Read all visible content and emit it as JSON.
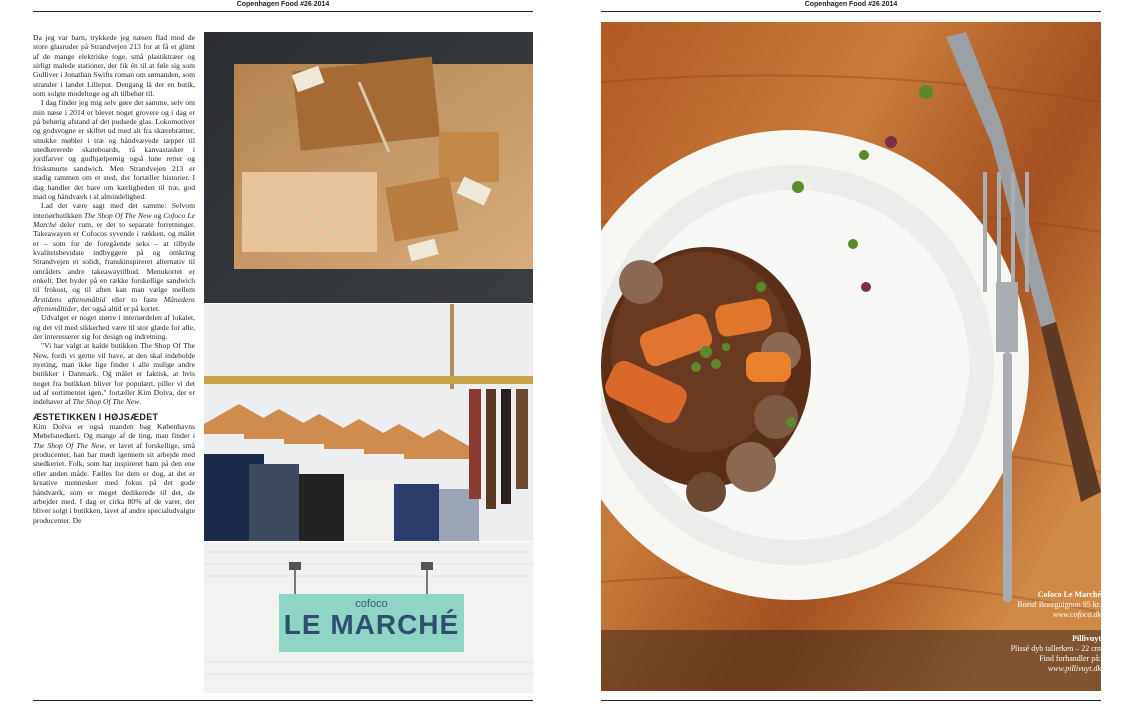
{
  "header": {
    "left": "Copenhagen Food #26 2014",
    "right": "Copenhagen Food #26 2014"
  },
  "article": {
    "p1": "Da jeg var barn, trykkede jeg næsen flad mod de store glasruder på Strandvejen 213 for at få et glimt af de mange elektriske toge, små plastiktræer og sirligt malede stationer, der fik én til at føle sig som Gulliver i Jonathan Swifts roman om sømanden, som strander i landet Lilleput. Dengang lå der en butik, som solgte modeltoge og alt tilbehør til.",
    "p2": "I dag finder jeg mig selv gøre det samme, selv om min næse i 2014 er blevet noget grovere og i dag er på behørig afstand af det pudsede glas. Lokomotiver og godsvogne er skiftet ud med alt fra skærebrætter, smukke møbler i træ og håndvævede tæpper til snedkererede skateboards, rå kanvastasker i jordfarver og gudhjælpemig også lune retter og frisksmurte sandwich. Men Strandvejen 213 er stadig rammen om et sted, der fortæller historier. I dag handler det bare om kærligheden til træ, god mad og håndværk i al almindelighed.",
    "p3a": "Lad det være sagt med det samme: Selvom interiørbutikken ",
    "p3b": "The Shop Of The New",
    "p3c": " og ",
    "p3d": "Cofoco Le Marché",
    "p3e": " deler rum, er det to separate forretninger. Takeawayen er Cofocos syvende i rækken, og målet er – som for de foregående seks – at tilbyde kvalitetsbevidste indbyggere på og omkring Strandvejen et solidt, franskinspireret alternativ til områdets andre takeawaytilbud. Menukortet er enkelt. Det byder på en række forskellige sandwich til frokost, og til aften kan man vælge mellem ",
    "p3f": "Årstidens aftensmåltid",
    "p3g": " eller to faste ",
    "p3h": "Månedens aftensmåltider",
    "p3i": ", der også altid er på kortet.",
    "p4": "Udvalget er noget større i interiørdelen af lokalet, og det vil med sikkerhed være til stor glæde for alle, der interesserer sig for design og indretning.",
    "p5a": "\"Vi har valgt at kalde butikken The Shop Of The New, fordi vi gerne vil have, at den skal indeholde nyeting, man ikke lige finder i alle mulige andre butikker i Danmark. Og målet er faktisk, at hvis noget fra butikken bliver for populært, piller vi det ud af sortimentet igen,\" fortæller Kim Dolva, der er indehaver af ",
    "p5b": "The Shop Of The New",
    "p5c": ".",
    "heading": "ÆSTETIKKEN I HØJSÆDET",
    "p6a": "Kim Dolva er også manden bag Københavns Møbelsnedkeri. Og mange af de ting, man finder i ",
    "p6b": "The Shop Of The New",
    "p6c": ", er lavet af forskellige, små producenter, han har mødt igennem sit arbejde med snedkeriet. Folk, som har inspireret ham på den ene eller anden måde. Fælles for dem er dog, at det er kreative mennesker med fokus på det gode håndværk, som er meget dedikerede til det, de arbejder med. I dag er cirka 80% af de varer, der bliver solgt i butikken, lavet af andre specialudvalgte producenter. De"
  },
  "sign": {
    "small": "cofoco",
    "big": "LE MARCHÉ"
  },
  "captions": {
    "c1_title": "Cofoco Le Marché",
    "c1_line": "Boeuf Bourguignon 95 kr.",
    "c1_url": "www.cofoco.dk",
    "c2_title": "Pillivuyt",
    "c2_line": "Plissé dyb tallerken – 22 cm",
    "c2_find": "Find forhandler på:",
    "c2_url": "www.pillivuyt.dk"
  },
  "colors": {
    "wood": "#b8672c",
    "sign": "#8ed5c5",
    "sign_text": "#2f4f6e"
  }
}
